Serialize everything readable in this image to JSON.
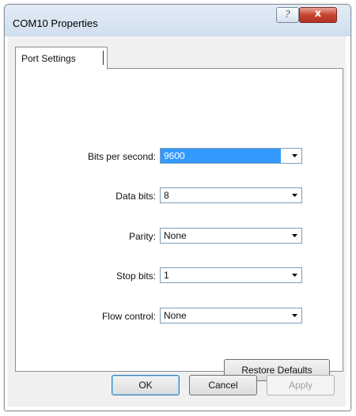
{
  "window": {
    "title": "COM10 Properties",
    "help_label": "?",
    "close_label": "x"
  },
  "tabs": [
    {
      "label": "Port Settings",
      "active": true
    }
  ],
  "fields": {
    "bits_per_second": {
      "label": "Bits per second:",
      "value": "9600",
      "selected": true
    },
    "data_bits": {
      "label": "Data bits:",
      "value": "8"
    },
    "parity": {
      "label": "Parity:",
      "value": "None"
    },
    "stop_bits": {
      "label": "Stop bits:",
      "value": "1"
    },
    "flow_control": {
      "label": "Flow control:",
      "value": "None"
    }
  },
  "restore_defaults_label": "Restore Defaults",
  "buttons": {
    "ok": "OK",
    "cancel": "Cancel",
    "apply": "Apply"
  },
  "colors": {
    "selection": "#3399ff",
    "close_button": "#c7432f",
    "titlebar": "#dce7f3"
  }
}
